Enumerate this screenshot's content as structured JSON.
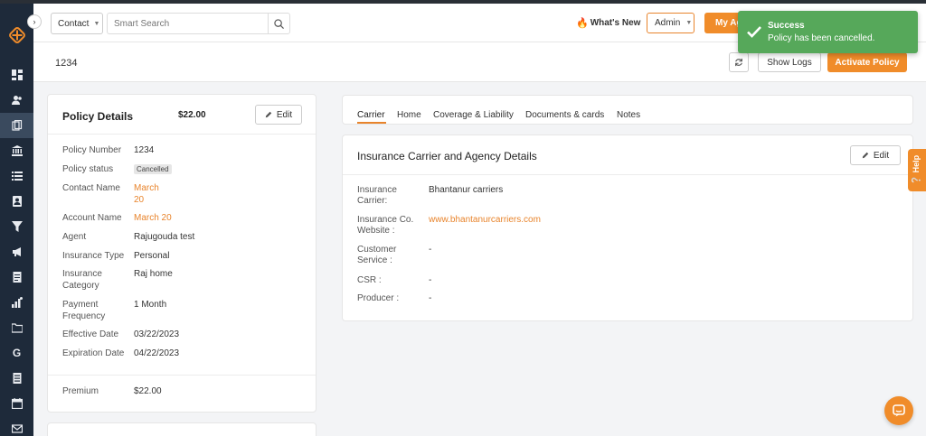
{
  "colors": {
    "accent": "#f08c2a",
    "sidebar_bg": "#1e2a3a",
    "toast_success": "#56a85a",
    "link": "#e8842c"
  },
  "sidebar": {
    "logo_icon": "brand-logo-icon",
    "collapse_glyph": "›",
    "items": [
      {
        "icon": "dashboard-icon",
        "active": false
      },
      {
        "icon": "users-icon",
        "active": false
      },
      {
        "icon": "policies-icon",
        "active": true
      },
      {
        "icon": "bank-icon",
        "active": false
      },
      {
        "icon": "list-icon",
        "active": false
      },
      {
        "icon": "contacts-icon",
        "active": false
      },
      {
        "icon": "funnel-icon",
        "active": false
      },
      {
        "icon": "megaphone-icon",
        "active": false
      },
      {
        "icon": "document-icon",
        "active": false
      },
      {
        "icon": "reports-icon",
        "active": false
      },
      {
        "icon": "folder-icon",
        "active": false
      },
      {
        "icon": "google-icon",
        "active": false,
        "glyph": "G"
      },
      {
        "icon": "invoice-icon",
        "active": false
      },
      {
        "icon": "calendar-icon",
        "active": false
      },
      {
        "icon": "mail-icon",
        "active": false
      }
    ]
  },
  "topbar": {
    "contact_select": "Contact",
    "search_placeholder": "Smart Search",
    "whats_new": "What's New",
    "admin_select": "Admin",
    "my_agency": "My Ag"
  },
  "page": {
    "title": "1234",
    "show_logs": "Show Logs",
    "activate_policy": "Activate Policy"
  },
  "policy_details": {
    "title": "Policy Details",
    "amount": "$22.00",
    "edit": "Edit",
    "fields": {
      "policy_number_label": "Policy Number",
      "policy_number_value": "1234",
      "policy_status_label": "Policy status",
      "policy_status_value": "Cancelled",
      "contact_name_label": "Contact Name",
      "contact_name_value_1": "March",
      "contact_name_value_2": "20",
      "account_name_label": "Account Name",
      "account_name_value": "March 20",
      "agent_label": "Agent",
      "agent_value": "Rajugouda test",
      "insurance_type_label": "Insurance Type",
      "insurance_type_value": "Personal",
      "insurance_category_label_1": "Insurance",
      "insurance_category_label_2": "Category",
      "insurance_category_value": "Raj home",
      "payment_frequency_label_1": "Payment",
      "payment_frequency_label_2": "Frequency",
      "payment_frequency_value": "1 Month",
      "effective_date_label": "Effective Date",
      "effective_date_value": "03/22/2023",
      "expiration_date_label": "Expiration Date",
      "expiration_date_value": "04/22/2023",
      "premium_label": "Premium",
      "premium_value": "$22.00"
    }
  },
  "tabs": [
    "Carrier",
    "Home",
    "Coverage & Liability",
    "Documents & cards",
    "Notes"
  ],
  "carrier": {
    "title": "Insurance Carrier and Agency Details",
    "edit": "Edit",
    "insurance_carrier_label_1": "Insurance",
    "insurance_carrier_label_2": "Carrier:",
    "insurance_carrier_value": "Bhantanur carriers",
    "website_label_1": "Insurance Co.",
    "website_label_2": "Website :",
    "website_value": "www.bhantanurcarriers.com",
    "customer_service_label_1": "Customer",
    "customer_service_label_2": "Service :",
    "customer_service_value": "-",
    "csr_label": "CSR :",
    "csr_value": "-",
    "producer_label": "Producer :",
    "producer_value": "-"
  },
  "toast": {
    "title": "Success",
    "message": "Policy has been cancelled."
  },
  "help": {
    "label": "Help"
  }
}
